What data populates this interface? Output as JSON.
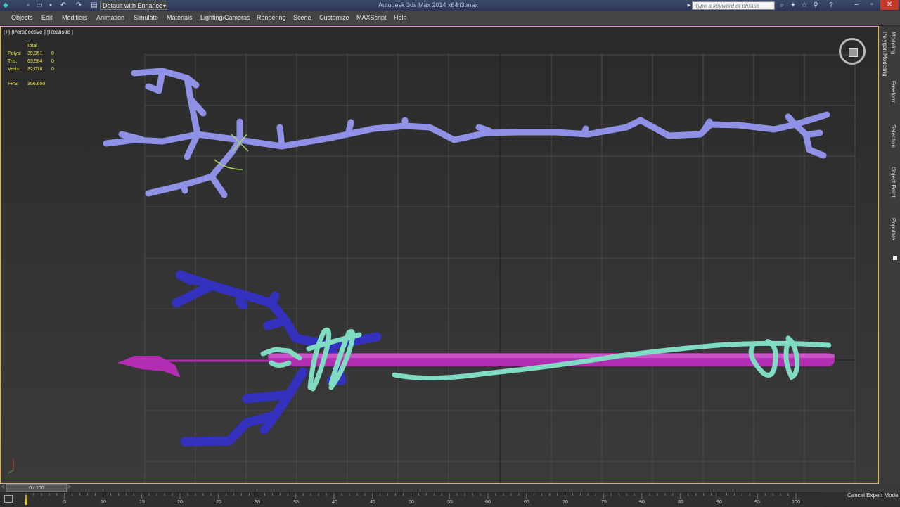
{
  "titlebar": {
    "workspace": "Default with Enhance",
    "app_title": "Autodesk 3ds Max  2014 x64",
    "file_name": "tri3.max",
    "search_placeholder": "Type a keyword or phrase"
  },
  "menu": [
    "Objects",
    "Edit",
    "Modifiers",
    "Animation",
    "Simulate",
    "Materials",
    "Lighting/Cameras",
    "Rendering",
    "Scene",
    "Customize",
    "MAXScript",
    "Help"
  ],
  "viewport": {
    "label": "[+] [Perspective ] [Realistic ]",
    "stats": {
      "header": "Total",
      "rows": [
        {
          "label": "Polys:",
          "total": "39,351",
          "sel": "0"
        },
        {
          "label": "Tris:",
          "total": "63,584",
          "sel": "0"
        },
        {
          "label": "Verts:",
          "total": "32,076",
          "sel": "0"
        }
      ],
      "fps_label": "FPS:",
      "fps_value": "356.650"
    }
  },
  "command_tabs": [
    "Modeling",
    "Polygon Modeling",
    "Freeform",
    "Selection",
    "Object Paint",
    "Populate"
  ],
  "timeline": {
    "frame": "0 / 100",
    "ticks": [
      "5",
      "10",
      "15",
      "20",
      "25",
      "30",
      "35",
      "40",
      "45",
      "50",
      "55",
      "60",
      "65",
      "70",
      "75",
      "80",
      "85",
      "90",
      "95",
      "100"
    ]
  },
  "status": {
    "cancel_expert": "Cancel Expert Mode"
  },
  "colors": {
    "branch_light": "#8f91e6",
    "branch_dark": "#3331bd",
    "shaft": "#b32db2",
    "rope": "#7fdcc2",
    "accent_viewport_border": "#f2b33d",
    "stats_text": "#f2e64d"
  }
}
